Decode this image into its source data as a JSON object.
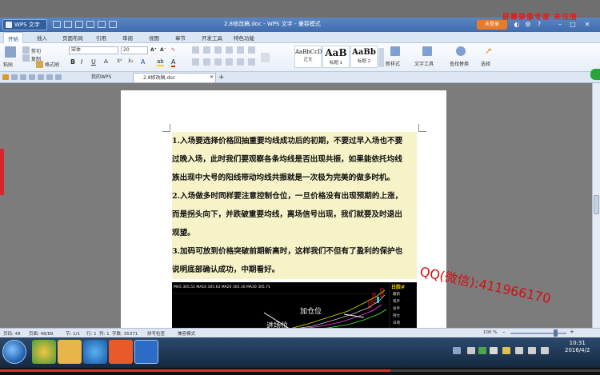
{
  "window": {
    "app_button": "WPS 文字",
    "title": "2.8修改稿.doc - WPS 文字 - 兼容模式",
    "login_button": "未登录",
    "recording_mark": "屏幕录像专家 未注册"
  },
  "menu": {
    "tabs": [
      "开始",
      "插入",
      "页面布局",
      "引用",
      "审阅",
      "视图",
      "章节",
      "开发工具",
      "特色功能"
    ],
    "active": "开始"
  },
  "ribbon": {
    "paste": "粘贴",
    "cut": "剪切",
    "copy": "复制",
    "format_painter": "格式刷",
    "font_name": "宋体",
    "font_size": "20",
    "styles": [
      {
        "preview": "AaBbCcD",
        "label": "正文"
      },
      {
        "preview": "AaB",
        "label": "标题 1"
      },
      {
        "preview": "AaBb",
        "label": "标题 2"
      }
    ],
    "new_style": "新样式",
    "text_tools": "文字工具",
    "find_replace": "查找替换",
    "select": "选择"
  },
  "doc_tabs": {
    "my_wps": "我的WPS",
    "file": "2.8修改稿.doc",
    "new_tab": "+"
  },
  "document": {
    "lines": [
      "1.入场要选择价格回抽重要均线成功后的初期，不要过早入场也不要",
      "过晚入场，此时我们要观察各条均线是否出现共振，如果能依托均线",
      "族出现中大号的阳线带动均线共振就是一次极为完美的做多时机。",
      "2.入场做多时同样要注意控制仓位，一旦价格没有出现预期的上涨，",
      "而是拐头向下，并跌破重要均线，离场信号出现，我们就要及时退出",
      "观望。",
      "3.加码可放到价格突破前期新高时，这样我们不但有了盈利的保护也",
      "说明底部确认成功，中期看好。"
    ],
    "chart_labels": {
      "ma": "MA5 305.51 MA10 305.63 MA20 305.16 MA30 305.71",
      "side_title": "日胶#",
      "side_items": [
        "最新",
        "现手",
        "总手",
        "持仓",
        "日增"
      ],
      "add_position": "加仓位",
      "entry_position": "进场位"
    }
  },
  "watermark": "QQ(微信):411966170",
  "status": {
    "page_no": "页码: 48",
    "pages": "页面: 48/89",
    "section": "节: 1/1",
    "row": "行: 1",
    "col": "列: 1",
    "words": "字数: 35371",
    "spell": "拼写检查",
    "compat": "兼容模式",
    "zoom": "100 %"
  },
  "taskbar": {
    "time": "10:31",
    "date": "2016/4/2"
  },
  "video_progress": 0.65,
  "colors": {
    "title_bar": "#3f6cae",
    "accent_red": "#e41b1b",
    "highlight": "#f6f3c9"
  }
}
